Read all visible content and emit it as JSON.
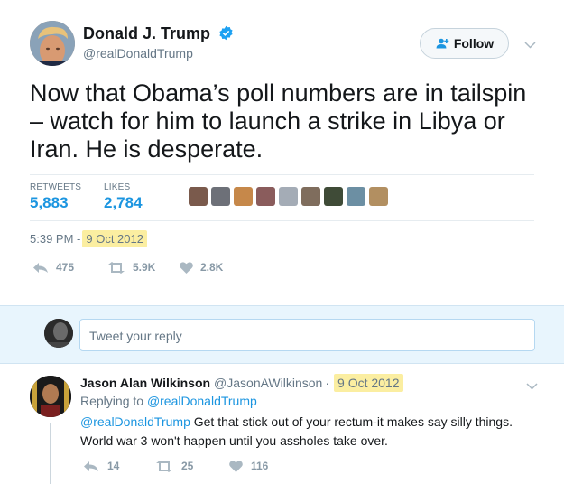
{
  "tweet": {
    "author_name": "Donald J. Trump",
    "author_handle": "@realDonaldTrump",
    "follow_label": "Follow",
    "text": "Now that Obama’s poll numbers are in tailspin – watch for him to launch a strike in Libya or Iran.  He is desperate.",
    "stats": {
      "retweets_label": "RETWEETS",
      "retweets_value": "5,883",
      "likes_label": "LIKES",
      "likes_value": "2,784"
    },
    "time": "5:39 PM -",
    "date": "9 Oct 2012",
    "actions": {
      "reply_count": "475",
      "retweet_count": "5.9K",
      "like_count": "2.8K"
    }
  },
  "reply_box": {
    "placeholder": "Tweet your reply"
  },
  "reply": {
    "author_name": "Jason Alan Wilkinson",
    "author_handle": "@JasonAWilkinson",
    "separator": "·",
    "date": "9 Oct 2012",
    "replying_prefix": "Replying to",
    "replying_to": "@realDonaldTrump",
    "mention": "@realDonaldTrump",
    "text": "Get that stick out of your rectum-it makes say silly things. World war 3 won't happen until you assholes take over.",
    "actions": {
      "reply_count": "14",
      "retweet_count": "25",
      "like_count": "116"
    }
  },
  "colors": {
    "accent": "#1b95e0",
    "highlight": "#fbeea1",
    "muted": "#657786",
    "reply_bg": "#e8f5fd"
  },
  "icons": [
    "verified-badge-icon",
    "follow-person-plus-icon",
    "chevron-down-icon",
    "reply-icon",
    "retweet-icon",
    "heart-icon"
  ]
}
